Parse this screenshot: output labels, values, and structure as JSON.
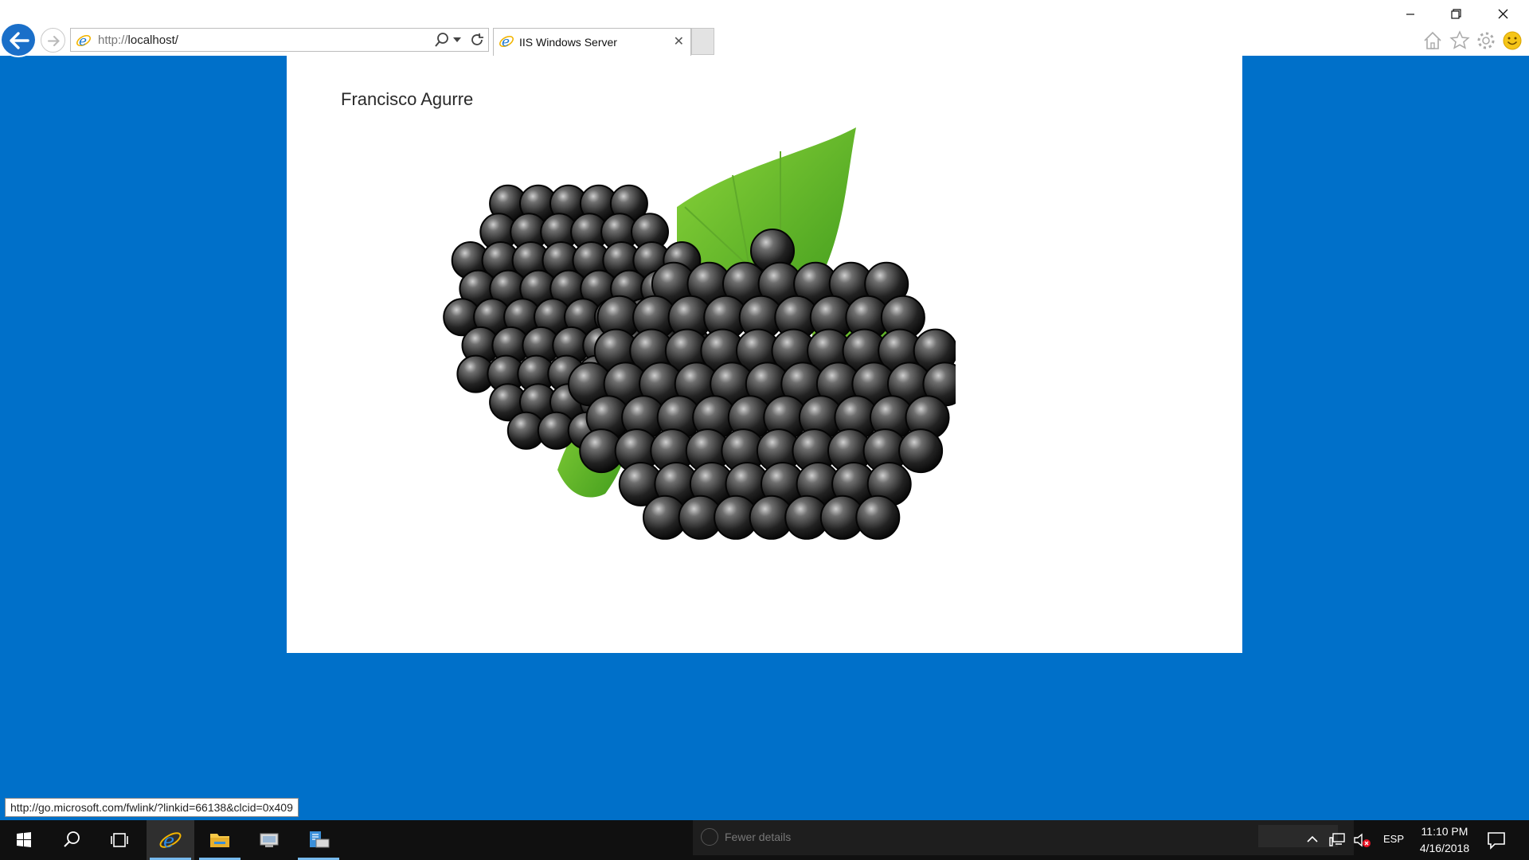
{
  "browser": {
    "address": {
      "protocol": "http://",
      "host": "localhost/"
    },
    "tabs": [
      {
        "title": "IIS Windows Server"
      }
    ],
    "tab_close_glyph": "✕",
    "window_controls": [
      "minimize-icon",
      "restore-icon",
      "close-icon"
    ],
    "toolbar_icons": [
      "home-icon",
      "favorites-star-icon",
      "gear-icon",
      "smiley-feedback-icon"
    ],
    "accent_color": "#1a6fc9"
  },
  "page": {
    "background_color": "#0070c9",
    "author_name": "Francisco Agurre",
    "hero_image": "blackberries-with-leaves"
  },
  "status_bar": {
    "hover_url": "http://go.microsoft.com/fwlink/?linkid=66138&clcid=0x409"
  },
  "taskbar": {
    "apps": [
      "start-icon",
      "search-icon",
      "task-view-icon",
      "internet-explorer-icon",
      "file-explorer-icon",
      "server-manager-icon",
      "iis-manager-icon"
    ],
    "notification": {
      "text": "Fewer details"
    },
    "tray": {
      "language": "ESP",
      "time": "11:10 PM",
      "date": "4/16/2018"
    }
  }
}
